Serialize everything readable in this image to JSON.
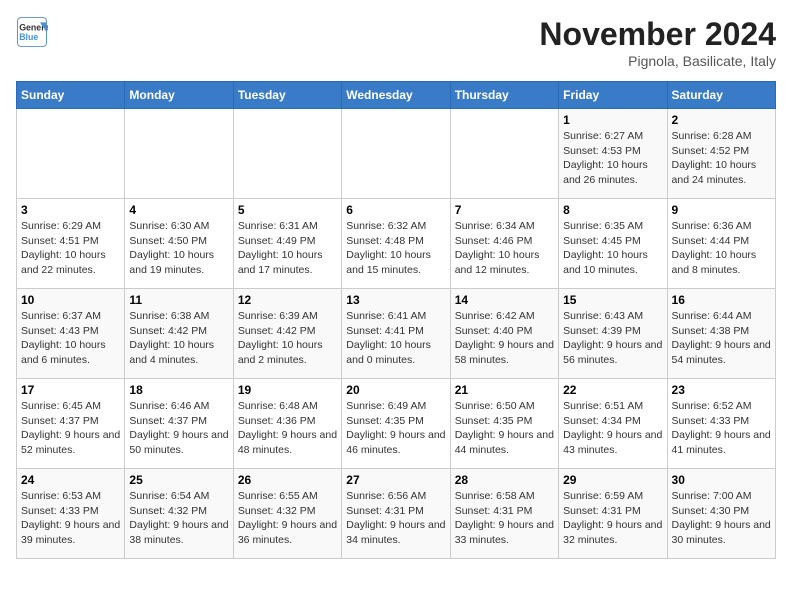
{
  "header": {
    "logo_line1": "General",
    "logo_line2": "Blue",
    "month_title": "November 2024",
    "location": "Pignola, Basilicate, Italy"
  },
  "weekdays": [
    "Sunday",
    "Monday",
    "Tuesday",
    "Wednesday",
    "Thursday",
    "Friday",
    "Saturday"
  ],
  "weeks": [
    [
      {
        "day": "",
        "info": ""
      },
      {
        "day": "",
        "info": ""
      },
      {
        "day": "",
        "info": ""
      },
      {
        "day": "",
        "info": ""
      },
      {
        "day": "",
        "info": ""
      },
      {
        "day": "1",
        "info": "Sunrise: 6:27 AM\nSunset: 4:53 PM\nDaylight: 10 hours and 26 minutes."
      },
      {
        "day": "2",
        "info": "Sunrise: 6:28 AM\nSunset: 4:52 PM\nDaylight: 10 hours and 24 minutes."
      }
    ],
    [
      {
        "day": "3",
        "info": "Sunrise: 6:29 AM\nSunset: 4:51 PM\nDaylight: 10 hours and 22 minutes."
      },
      {
        "day": "4",
        "info": "Sunrise: 6:30 AM\nSunset: 4:50 PM\nDaylight: 10 hours and 19 minutes."
      },
      {
        "day": "5",
        "info": "Sunrise: 6:31 AM\nSunset: 4:49 PM\nDaylight: 10 hours and 17 minutes."
      },
      {
        "day": "6",
        "info": "Sunrise: 6:32 AM\nSunset: 4:48 PM\nDaylight: 10 hours and 15 minutes."
      },
      {
        "day": "7",
        "info": "Sunrise: 6:34 AM\nSunset: 4:46 PM\nDaylight: 10 hours and 12 minutes."
      },
      {
        "day": "8",
        "info": "Sunrise: 6:35 AM\nSunset: 4:45 PM\nDaylight: 10 hours and 10 minutes."
      },
      {
        "day": "9",
        "info": "Sunrise: 6:36 AM\nSunset: 4:44 PM\nDaylight: 10 hours and 8 minutes."
      }
    ],
    [
      {
        "day": "10",
        "info": "Sunrise: 6:37 AM\nSunset: 4:43 PM\nDaylight: 10 hours and 6 minutes."
      },
      {
        "day": "11",
        "info": "Sunrise: 6:38 AM\nSunset: 4:42 PM\nDaylight: 10 hours and 4 minutes."
      },
      {
        "day": "12",
        "info": "Sunrise: 6:39 AM\nSunset: 4:42 PM\nDaylight: 10 hours and 2 minutes."
      },
      {
        "day": "13",
        "info": "Sunrise: 6:41 AM\nSunset: 4:41 PM\nDaylight: 10 hours and 0 minutes."
      },
      {
        "day": "14",
        "info": "Sunrise: 6:42 AM\nSunset: 4:40 PM\nDaylight: 9 hours and 58 minutes."
      },
      {
        "day": "15",
        "info": "Sunrise: 6:43 AM\nSunset: 4:39 PM\nDaylight: 9 hours and 56 minutes."
      },
      {
        "day": "16",
        "info": "Sunrise: 6:44 AM\nSunset: 4:38 PM\nDaylight: 9 hours and 54 minutes."
      }
    ],
    [
      {
        "day": "17",
        "info": "Sunrise: 6:45 AM\nSunset: 4:37 PM\nDaylight: 9 hours and 52 minutes."
      },
      {
        "day": "18",
        "info": "Sunrise: 6:46 AM\nSunset: 4:37 PM\nDaylight: 9 hours and 50 minutes."
      },
      {
        "day": "19",
        "info": "Sunrise: 6:48 AM\nSunset: 4:36 PM\nDaylight: 9 hours and 48 minutes."
      },
      {
        "day": "20",
        "info": "Sunrise: 6:49 AM\nSunset: 4:35 PM\nDaylight: 9 hours and 46 minutes."
      },
      {
        "day": "21",
        "info": "Sunrise: 6:50 AM\nSunset: 4:35 PM\nDaylight: 9 hours and 44 minutes."
      },
      {
        "day": "22",
        "info": "Sunrise: 6:51 AM\nSunset: 4:34 PM\nDaylight: 9 hours and 43 minutes."
      },
      {
        "day": "23",
        "info": "Sunrise: 6:52 AM\nSunset: 4:33 PM\nDaylight: 9 hours and 41 minutes."
      }
    ],
    [
      {
        "day": "24",
        "info": "Sunrise: 6:53 AM\nSunset: 4:33 PM\nDaylight: 9 hours and 39 minutes."
      },
      {
        "day": "25",
        "info": "Sunrise: 6:54 AM\nSunset: 4:32 PM\nDaylight: 9 hours and 38 minutes."
      },
      {
        "day": "26",
        "info": "Sunrise: 6:55 AM\nSunset: 4:32 PM\nDaylight: 9 hours and 36 minutes."
      },
      {
        "day": "27",
        "info": "Sunrise: 6:56 AM\nSunset: 4:31 PM\nDaylight: 9 hours and 34 minutes."
      },
      {
        "day": "28",
        "info": "Sunrise: 6:58 AM\nSunset: 4:31 PM\nDaylight: 9 hours and 33 minutes."
      },
      {
        "day": "29",
        "info": "Sunrise: 6:59 AM\nSunset: 4:31 PM\nDaylight: 9 hours and 32 minutes."
      },
      {
        "day": "30",
        "info": "Sunrise: 7:00 AM\nSunset: 4:30 PM\nDaylight: 9 hours and 30 minutes."
      }
    ]
  ]
}
